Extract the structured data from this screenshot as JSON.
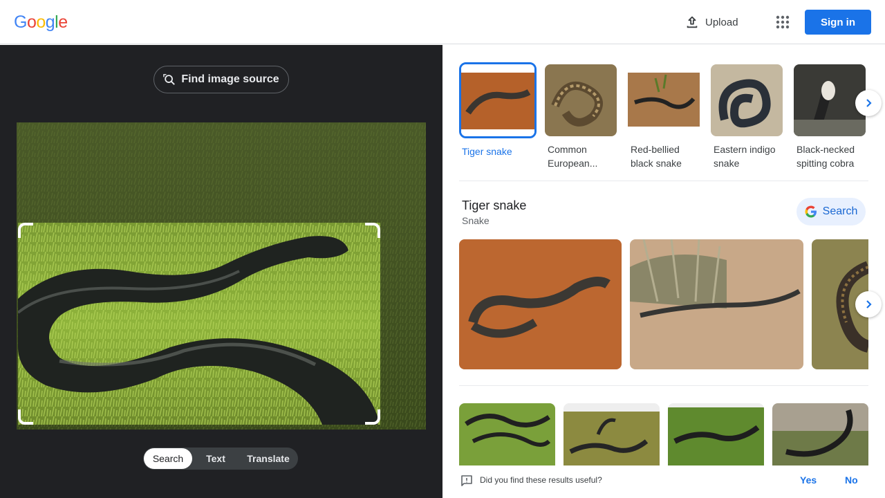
{
  "header": {
    "logo_letters": [
      "G",
      "o",
      "o",
      "g",
      "l",
      "e"
    ],
    "logo_colors": [
      "#4285f4",
      "#ea4335",
      "#fbbc05",
      "#4285f4",
      "#34a853",
      "#ea4335"
    ],
    "upload_label": "Upload",
    "signin_label": "Sign in"
  },
  "left_panel": {
    "find_source_label": "Find image source",
    "tabs": [
      {
        "label": "Search",
        "active": true
      },
      {
        "label": "Text",
        "active": false
      },
      {
        "label": "Translate",
        "active": false
      }
    ]
  },
  "matches": [
    {
      "label": "Tiger snake",
      "selected": true
    },
    {
      "label": "Common European...",
      "selected": false
    },
    {
      "label": "Red-bellied black snake",
      "selected": false
    },
    {
      "label": "Eastern indigo snake",
      "selected": false
    },
    {
      "label": "Black-necked spitting cobra",
      "selected": false
    }
  ],
  "knowledge": {
    "title": "Tiger snake",
    "subtitle": "Snake",
    "search_label": "Search"
  },
  "feedback": {
    "question": "Did you find these results useful?",
    "yes": "Yes",
    "no": "No"
  },
  "colors": {
    "accent": "#1a73e8",
    "dark_panel": "#202124"
  }
}
